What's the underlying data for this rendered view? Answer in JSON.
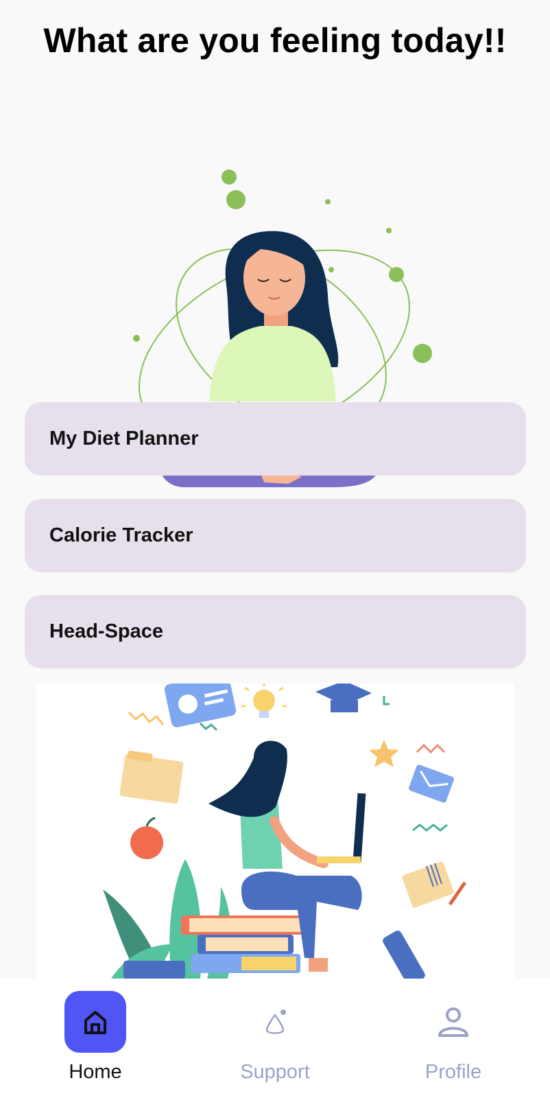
{
  "header": {
    "title": "What are you feeling today!!"
  },
  "menu": [
    {
      "label": "My Diet Planner"
    },
    {
      "label": "Calorie Tracker"
    },
    {
      "label": "Head-Space"
    }
  ],
  "nav": {
    "items": [
      {
        "label": "Home",
        "icon": "home-icon",
        "active": true
      },
      {
        "label": "Support",
        "icon": "support-icon",
        "active": false
      },
      {
        "label": "Profile",
        "icon": "profile-icon",
        "active": false
      }
    ]
  },
  "colors": {
    "accent": "#5055f5",
    "card_bg": "#e7e0ec",
    "inactive_nav": "#9aa3c7",
    "leaf_green": "#8bbf5a"
  }
}
